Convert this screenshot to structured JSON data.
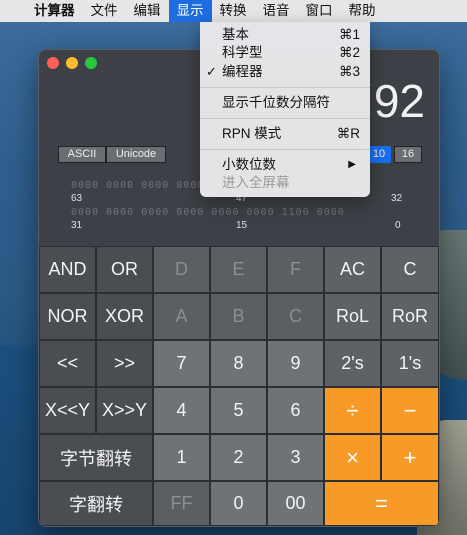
{
  "menubar": {
    "apple_icon": "",
    "items": [
      "计算器",
      "文件",
      "编辑",
      "显示",
      "转换",
      "语音",
      "窗口",
      "帮助"
    ],
    "active": "显示"
  },
  "view_menu": {
    "items": [
      {
        "label": "基本",
        "shortcut": "⌘1",
        "checked": false
      },
      {
        "label": "科学型",
        "shortcut": "⌘2",
        "checked": false
      },
      {
        "label": "编程器",
        "shortcut": "⌘3",
        "checked": true
      },
      {
        "label": "显示千位数分隔符",
        "shortcut": "",
        "checked": false
      },
      {
        "label": "RPN 模式",
        "shortcut": "⌘R",
        "checked": false
      },
      {
        "label": "小数位数",
        "shortcut": "",
        "submenu": true
      },
      {
        "label": "进入全屏幕",
        "shortcut": "",
        "disabled": true
      }
    ],
    "check_mark": "✓",
    "submenu_arrow": "▶"
  },
  "calculator": {
    "display_value": "92",
    "encoding": {
      "ascii": "ASCII",
      "unicode": "Unicode"
    },
    "base": {
      "ten": "10",
      "sixteen": "16",
      "selected": "10"
    },
    "bits_row1": "0000 0000 0000 0000 0000 0000 0000 0000",
    "bits_row2": "0000 0000 0000 0000 0000 0000 1100 0000",
    "bit_positions": {
      "r1_left": "63",
      "r1_mid": "47",
      "r1_right": "32",
      "r2_left": "31",
      "r2_mid": "15",
      "r2_right": "0"
    },
    "keys": {
      "and": "AND",
      "or": "OR",
      "d": "D",
      "e": "E",
      "f": "F",
      "ac": "AC",
      "c": "C",
      "nor": "NOR",
      "xor": "XOR",
      "a": "A",
      "b": "B",
      "c_hex": "C",
      "rol": "RoL",
      "ror": "RoR",
      "lshift": "<<",
      "rshift": ">>",
      "n7": "7",
      "n8": "8",
      "n9": "9",
      "twos": "2's",
      "ones": "1's",
      "xly": "X<<Y",
      "xry": "X>>Y",
      "n4": "4",
      "n5": "5",
      "n6": "6",
      "div": "÷",
      "minus": "−",
      "byte_flip": "字节翻转",
      "n1": "1",
      "n2": "2",
      "n3": "3",
      "mul": "×",
      "plus": "+",
      "word_flip": "字翻转",
      "ff": "FF",
      "n0": "0",
      "n00": "00",
      "eq": "="
    }
  },
  "colors": {
    "accent": "#1e6de0",
    "operator": "#f79a28",
    "base_selected": "#1a6ff0"
  }
}
